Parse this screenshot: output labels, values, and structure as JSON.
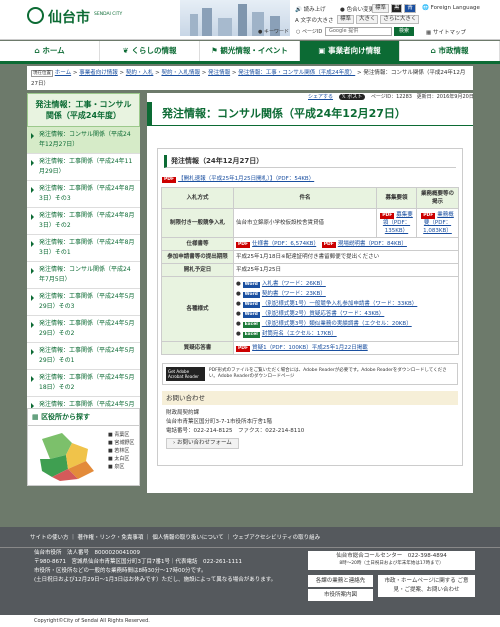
{
  "header": {
    "logo_text": "仙台市",
    "logo_sub": "SENDAI CITY",
    "tool_read": "読み上げ",
    "tool_color": "色合い変更",
    "tool_color_opts": [
      "標準",
      "黒",
      "青"
    ],
    "tool_size": "文字の大きさ",
    "tool_size_opts": [
      "標準",
      "大きく",
      "さらに大きく"
    ],
    "lang": "Foreign Language",
    "search_radio1": "キーワード",
    "search_radio2": "ページID",
    "search_placeholder": "Google 提供",
    "search_btn": "検索",
    "sitemap": "サイトマップ"
  },
  "nav": [
    {
      "label": "ホーム"
    },
    {
      "label": "くらしの情報"
    },
    {
      "label": "観光情報・イベント"
    },
    {
      "label": "事業者向け情報"
    },
    {
      "label": "市政情報"
    }
  ],
  "breadcrumb": {
    "label": "現在位置",
    "items": [
      "ホーム",
      "事業者向け情報",
      "契約・入札",
      "契約・入札情報",
      "発注情報",
      "発注情報：工事・コンサル関係（平成24年度）"
    ],
    "current": "発注情報：コンサル関係（平成24年12月27日）"
  },
  "share": {
    "share_label": "シェアする",
    "tweet": "ポスト",
    "page_id": "ページID：12283",
    "updated": "更新日：2016年9月20日"
  },
  "sidebar": {
    "heading": "発注情報：工事・コンサル関係（平成24年度）",
    "items": [
      {
        "label": "発注情報：コンサル関係（平成24年12月27日）"
      },
      {
        "label": "発注情報：工事関係（平成24年11月29日）"
      },
      {
        "label": "発注情報：工事関係（平成24年8月3日）その3"
      },
      {
        "label": "発注情報：工事関係（平成24年8月3日）その2"
      },
      {
        "label": "発注情報：工事関係（平成24年8月3日）その1"
      },
      {
        "label": "発注情報：コンサル関係（平成24年7月5日）"
      },
      {
        "label": "発注情報：工事関係（平成24年5月29日）その3"
      },
      {
        "label": "発注情報：工事関係（平成24年5月29日）その2"
      },
      {
        "label": "発注情報：工事関係（平成24年5月29日）その1"
      },
      {
        "label": "発注情報：工事関係（平成24年5月18日）その2"
      },
      {
        "label": "発注情報：工事関係（平成24年5月18日）その1"
      }
    ],
    "ward_title": "区役所から探す",
    "wards": [
      "青葉区",
      "宮城野区",
      "若林区",
      "太白区",
      "泉区"
    ]
  },
  "main": {
    "title": "発注情報：コンサル関係（平成24年12月27日）",
    "section_title": "発注情報（24年12月27日）",
    "kaiho_link": "【開札速報（平成25年1月25日開札）】（PDF：54KB）",
    "table": {
      "h_method": "入札方式",
      "h_name": "件名",
      "h_design": "募集要領",
      "h_spec": "業務概要等の掲示",
      "method": "制限付き一般競争入札",
      "name": "仙台市立錦原小学校仮設校舎賃貸借",
      "design_link": "募集要領（PDF：135KB）",
      "spec_link": "業務概要（PDF：1,083KB）",
      "r_spec": "仕様書等",
      "spec_doc1": "仕様書（PDF：6,574KB）",
      "spec_doc2": "現場説明書（PDF：84KB）",
      "r_deadline": "参加申請書等の提出期限",
      "deadline": "平成25年1月18日※配達証明付き書留郵便で提出ください",
      "r_open": "開札予定日",
      "open": "平成25年1月25日",
      "r_forms": "各種様式",
      "forms": [
        {
          "type": "Word",
          "text": "入札書（ワード：26KB）"
        },
        {
          "type": "Word",
          "text": "契約書（ワード：23KB）"
        },
        {
          "type": "Word",
          "text": "（別記様式第1号）一般競争入札参加申請書（ワード：33KB）"
        },
        {
          "type": "Word",
          "text": "（別記様式第2号）質疑応答書（ワード：43KB）"
        },
        {
          "type": "Excel",
          "text": "（別記様式第3号）類似業務の実績調書（エクセル：20KB）"
        },
        {
          "type": "Excel",
          "text": "封筒宛名（エクセル：17KB）"
        }
      ],
      "r_qa": "質疑応答書",
      "qa": "質疑1（PDF：100KB）平成25年1月22日掲載"
    },
    "adobe_note": "PDF形式のファイルをご覧いただく場合には、Adobe Readerが必要です。Adobe Readerをダウンロードしてください。Adobe Readerのダウンロードページ",
    "adobe_badge": "Get Adobe Acrobat Reader",
    "contact_title": "お問い合わせ",
    "contact_lines": [
      "財政局契約課",
      "仙台市青葉区国分町3-7-1市役所本庁舎1階",
      "電話番号：022-214-8125　ファクス：022-214-8110"
    ],
    "contact_btn": "お問い合わせフォーム"
  },
  "footer": {
    "links": [
      "サイトの使い方",
      "著作権・リンク・免責事項",
      "個人情報の取り扱いについて",
      "ウェブアクセシビリティの取り組み"
    ],
    "org": "仙台市役所　法人番号　8000020041009",
    "addr": "〒980-8671　宮城県仙台市青葉区国分町3丁目7番1号｜代表電話　022-261-1111",
    "hours1": "市役所・区役所などの一般的な業務時間は8時30分～17時00分です。",
    "hours2": "(土日祝日および12月29日～1月3日はお休みです）ただし、施設によって異なる場合があります。",
    "call_center": "仙台市総合コールセンター　022-398-4894",
    "call_hours": "8時～20時（土日祝日および年末年始は17時まで）",
    "btn1": "各課の業務と連絡先",
    "btn2": "市政・ホームページに関する ご意見・ご提案、お問い合わせ",
    "btn3": "市役所案内図",
    "copyright": "Copyright©City of Sendai All Rights Reserved."
  }
}
